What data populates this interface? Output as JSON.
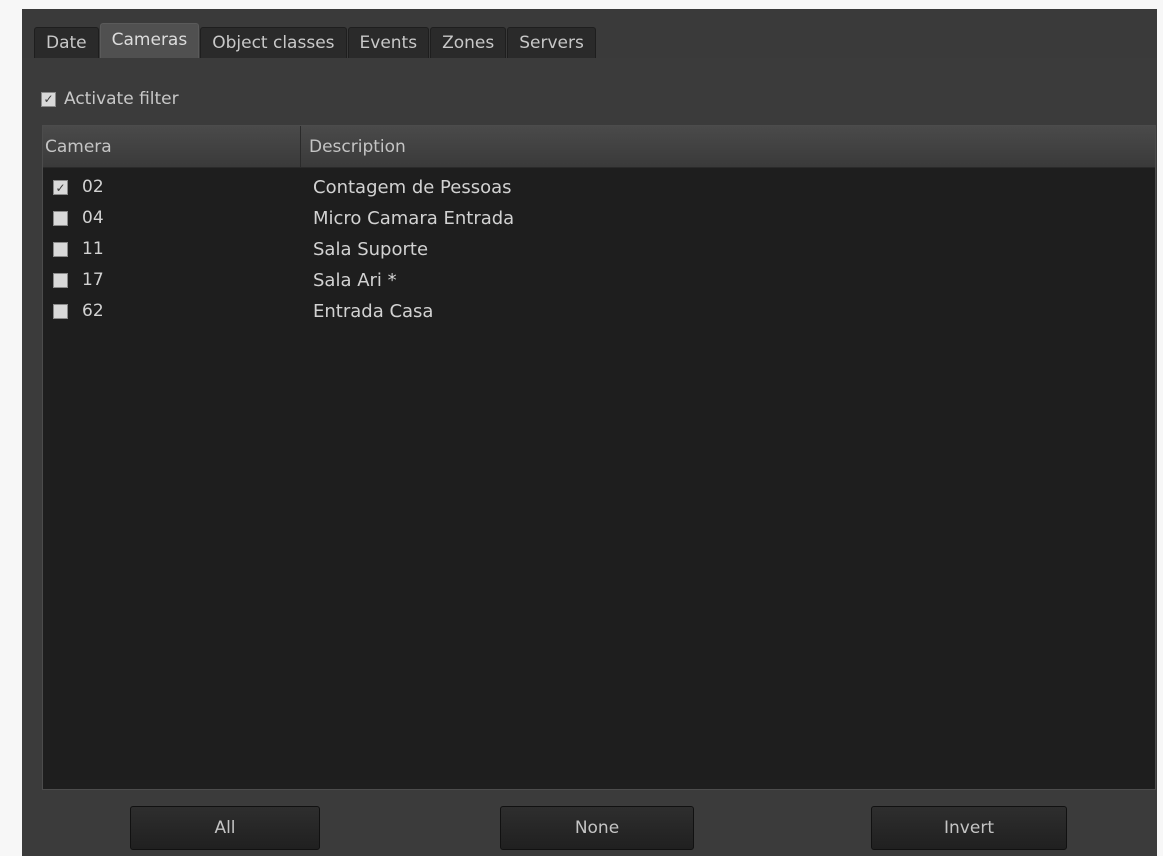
{
  "tabs": [
    {
      "label": "Date",
      "active": false
    },
    {
      "label": "Cameras",
      "active": true
    },
    {
      "label": "Object classes",
      "active": false
    },
    {
      "label": "Events",
      "active": false
    },
    {
      "label": "Zones",
      "active": false
    },
    {
      "label": "Servers",
      "active": false
    }
  ],
  "filter": {
    "label": "Activate filter",
    "checked": true
  },
  "table": {
    "columns": [
      "Camera",
      "Description"
    ],
    "rows": [
      {
        "camera": "02",
        "description": "Contagem de Pessoas",
        "checked": true
      },
      {
        "camera": "04",
        "description": "Micro Camara Entrada",
        "checked": false
      },
      {
        "camera": "11",
        "description": "Sala Suporte",
        "checked": false
      },
      {
        "camera": "17",
        "description": "Sala Ari *",
        "checked": false
      },
      {
        "camera": "62",
        "description": "Entrada Casa",
        "checked": false
      }
    ]
  },
  "buttons": {
    "all": "All",
    "none": "None",
    "invert": "Invert"
  },
  "colors": {
    "panel": "#3b3b3b",
    "list_bg": "#1e1e1e",
    "tab_active": "#505050"
  }
}
